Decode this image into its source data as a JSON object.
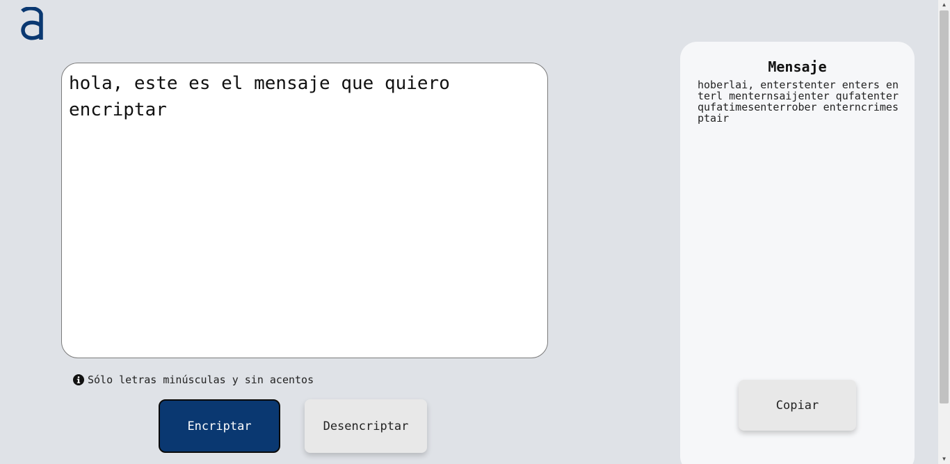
{
  "header": {
    "logo_icon": "alura-a-logo-icon",
    "brand_color": "#0a3871"
  },
  "editor": {
    "value": "hola, este es el mensaje que quiero encriptar"
  },
  "hint": {
    "icon": "info-circle-icon",
    "text": "Sólo letras minúsculas y sin acentos"
  },
  "buttons": {
    "encrypt_label": "Encriptar",
    "decrypt_label": "Desencriptar",
    "copy_label": "Copiar"
  },
  "result_panel": {
    "title": "Mensaje",
    "text": "hoberlai, enterstenter enters enterl menternsaijenter qufatenter qufatimesenterrober enterncrimesptair"
  },
  "colors": {
    "background": "#dfe2e7",
    "primary_button": "#0a3871",
    "secondary_button": "#e8e8e8",
    "panel": "#f6f7f9"
  }
}
